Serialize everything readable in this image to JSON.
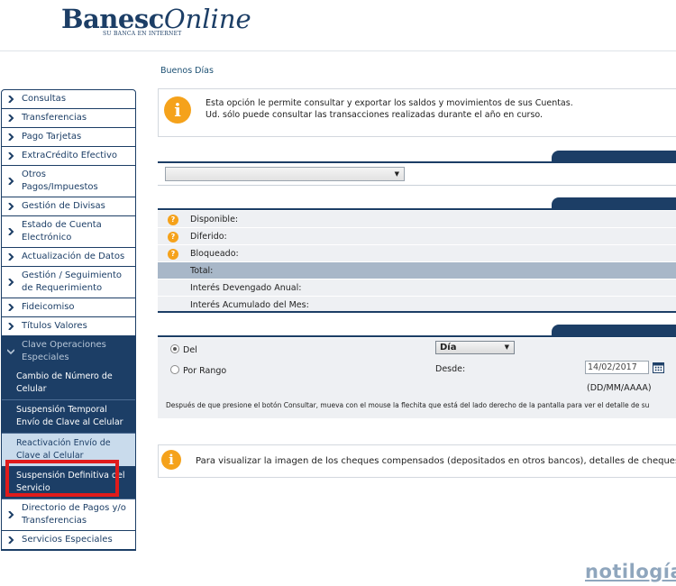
{
  "brand": {
    "main": "Banesc",
    "online": "Online",
    "tagline": "SU BANCA EN INTERNET"
  },
  "greeting": "Buenos Días",
  "sidebar": {
    "items": [
      {
        "label": "Consultas"
      },
      {
        "label": "Transferencias"
      },
      {
        "label": "Pago Tarjetas"
      },
      {
        "label": "ExtraCrédito Efectivo"
      },
      {
        "label": "Otros Pagos/Impuestos"
      },
      {
        "label": "Gestión de Divisas"
      },
      {
        "label": "Estado de Cuenta Electrónico"
      },
      {
        "label": "Actualización de Datos"
      },
      {
        "label": "Gestión / Seguimiento de Requerimiento"
      },
      {
        "label": "Fideicomiso"
      },
      {
        "label": "Títulos Valores"
      }
    ],
    "open_group": {
      "label": "Clave Operaciones Especiales",
      "subitems": [
        {
          "label": "Cambio de Número de Celular"
        },
        {
          "label": "Suspensión Temporal Envío de Clave al Celular"
        },
        {
          "label": "Reactivación Envío de Clave al Celular"
        },
        {
          "label": "Suspensión Definitiva del Servicio"
        }
      ]
    },
    "after_items": [
      {
        "label": "Directorio de Pagos y/o Transferencias"
      },
      {
        "label": "Servicios Especiales"
      }
    ]
  },
  "info": {
    "line1": "Esta opción le permite consultar y exportar los saldos y movimientos de sus Cuentas.",
    "line2": "Ud. sólo puede consultar las transacciones realizadas durante el año en curso."
  },
  "account_select": {
    "value": ""
  },
  "balances": {
    "disponible": "Disponible:",
    "diferido": "Diferido:",
    "bloqueado": "Bloqueado:",
    "total": "Total:",
    "interes_anual": "Interés Devengado Anual:",
    "interes_mes": "Interés Acumulado del Mes:"
  },
  "period": {
    "del_label": "Del",
    "rango_label": "Por Rango",
    "period_value": "Día",
    "desde_label": "Desde:",
    "desde_value": "14/02/2017",
    "date_format": "(DD/MM/AAAA)",
    "note": "Después de que presione el botón Consultar, mueva con el mouse la flechita que está del lado derecho de la pantalla para ver el detalle de su"
  },
  "cheques": {
    "text": "Para visualizar la imagen de los cheques compensados (depositados en otros bancos), detalles de cheques de"
  },
  "watermark": "notilogía",
  "colors": {
    "navy": "#1c3e66",
    "orange": "#f5a21b",
    "highlight": "#e01b1b"
  }
}
